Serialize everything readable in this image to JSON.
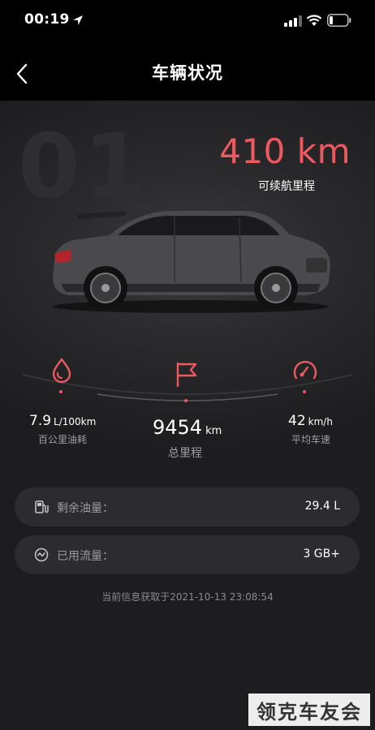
{
  "status_bar": {
    "time": "00:19"
  },
  "nav": {
    "title": "车辆状况"
  },
  "hero": {
    "bg_number": "01",
    "range_value": "410 km",
    "range_label": "可续航里程"
  },
  "stats": {
    "fuel_consumption": {
      "value": "7.9",
      "unit": "L/100km",
      "label": "百公里油耗",
      "icon": "fuel-drop-icon"
    },
    "odometer": {
      "value": "9454",
      "unit": "km",
      "label": "总里程",
      "icon": "flag-icon"
    },
    "avg_speed": {
      "value": "42",
      "unit": "km/h",
      "label": "平均车速",
      "icon": "speedometer-icon"
    }
  },
  "cards": [
    {
      "label": "剩余油量：",
      "value": "29.4 L",
      "icon": "fuel-pump-icon"
    },
    {
      "label": "已用流量：",
      "value": "3 GB+",
      "icon": "data-usage-icon"
    }
  ],
  "timestamp": "当前信息获取于2021-10-13 23:08:54",
  "watermark": "领克车友会",
  "colors": {
    "accent": "#ec5a5f",
    "background": "#000000",
    "card": "#2c2c30"
  }
}
